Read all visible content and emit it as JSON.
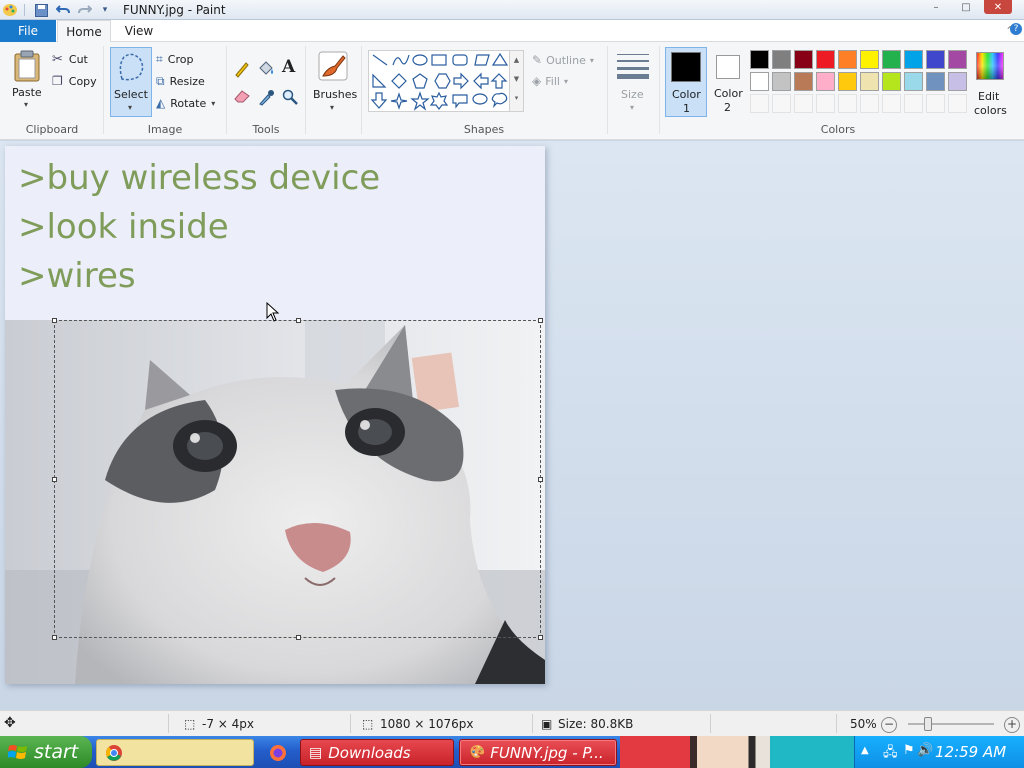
{
  "window": {
    "title": "FUNNY.jpg - Paint",
    "controls": {
      "minimize": "–",
      "maximize": "□",
      "close": "✕"
    }
  },
  "tabs": {
    "file": "File",
    "home": "Home",
    "view": "View"
  },
  "ribbon": {
    "clipboard": {
      "paste": "Paste",
      "cut": "Cut",
      "copy": "Copy",
      "label": "Clipboard"
    },
    "image": {
      "select": "Select",
      "crop": "Crop",
      "resize": "Resize",
      "rotate": "Rotate",
      "label": "Image"
    },
    "tools": {
      "label": "Tools"
    },
    "brushes": {
      "label": "Brushes"
    },
    "shapes": {
      "outline": "Outline",
      "fill": "Fill",
      "label": "Shapes"
    },
    "size": {
      "label": "Size"
    },
    "colors": {
      "color1": "Color",
      "color1_num": "1",
      "color2": "Color",
      "color2_num": "2",
      "edit1": "Edit",
      "edit2": "colors",
      "label": "Colors",
      "row1": [
        "#000000",
        "#7f7f7f",
        "#880015",
        "#ed1c24",
        "#ff7f27",
        "#fff200",
        "#22b14c",
        "#00a2e8",
        "#3f48cc",
        "#a349a4"
      ],
      "row2": [
        "#ffffff",
        "#c3c3c3",
        "#b97a57",
        "#ffaec9",
        "#ffc90e",
        "#efe4b0",
        "#b5e61d",
        "#99d9ea",
        "#7092be",
        "#c8bfe7"
      ]
    }
  },
  "canvas": {
    "lines": [
      ">buy wireless device",
      ">look inside",
      ">wires"
    ]
  },
  "statusbar": {
    "selection_offset": "-7 × 4px",
    "image_size": "1080 × 1076px",
    "file_size": "Size: 80.8KB",
    "zoom": "50%"
  },
  "taskbar": {
    "start": "start",
    "downloads": "Downloads",
    "paint_task": "FUNNY.jpg - P...",
    "clock": "12:59 AM"
  }
}
